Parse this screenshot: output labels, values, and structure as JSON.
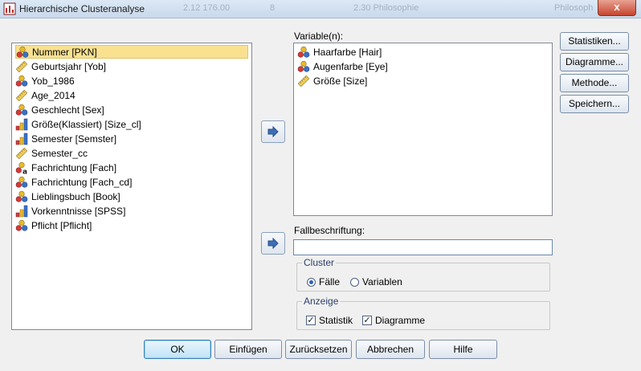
{
  "window": {
    "title": "Hierarchische Clusteranalyse",
    "background_tabs": [
      "2.12 176.00",
      "8",
      "2.30 Philosophie",
      "Philosoph"
    ],
    "close_label": "x"
  },
  "source_list": {
    "items": [
      {
        "label": "Nummer [PKN]",
        "icon": "nominal-icon",
        "selected": true
      },
      {
        "label": "Geburtsjahr [Yob]",
        "icon": "scale-icon"
      },
      {
        "label": "Yob_1986",
        "icon": "nominal-icon"
      },
      {
        "label": "Age_2014",
        "icon": "scale-icon"
      },
      {
        "label": "Geschlecht [Sex]",
        "icon": "nominal-icon"
      },
      {
        "label": "Größe(Klassiert) [Size_cl]",
        "icon": "ordinal-icon"
      },
      {
        "label": "Semester [Semster]",
        "icon": "ordinal-icon"
      },
      {
        "label": "Semester_cc",
        "icon": "scale-icon"
      },
      {
        "label": "Fachrichtung [Fach]",
        "icon": "nominal-string-icon"
      },
      {
        "label": "Fachrichtung [Fach_cd]",
        "icon": "nominal-icon"
      },
      {
        "label": "Lieblingsbuch [Book]",
        "icon": "nominal-icon"
      },
      {
        "label": "Vorkenntnisse [SPSS]",
        "icon": "ordinal-icon"
      },
      {
        "label": "Pflicht [Pflicht]",
        "icon": "nominal-icon"
      }
    ]
  },
  "variables": {
    "label": "Variable(n):",
    "items": [
      {
        "label": "Haarfarbe [Hair]",
        "icon": "nominal-icon"
      },
      {
        "label": "Augenfarbe [Eye]",
        "icon": "nominal-icon"
      },
      {
        "label": "Größe [Size]",
        "icon": "scale-icon"
      }
    ]
  },
  "case_label": {
    "label": "Fallbeschriftung:",
    "value": ""
  },
  "cluster_group": {
    "title": "Cluster",
    "options": [
      "Fälle",
      "Variablen"
    ],
    "selected": "Fälle"
  },
  "display_group": {
    "title": "Anzeige",
    "options": [
      {
        "label": "Statistik",
        "checked": true
      },
      {
        "label": "Diagramme",
        "checked": true
      }
    ]
  },
  "side_buttons": [
    "Statistiken...",
    "Diagramme...",
    "Methode...",
    "Speichern..."
  ],
  "bottom_buttons": [
    "OK",
    "Einfügen",
    "Zurücksetzen",
    "Abbrechen",
    "Hilfe"
  ]
}
